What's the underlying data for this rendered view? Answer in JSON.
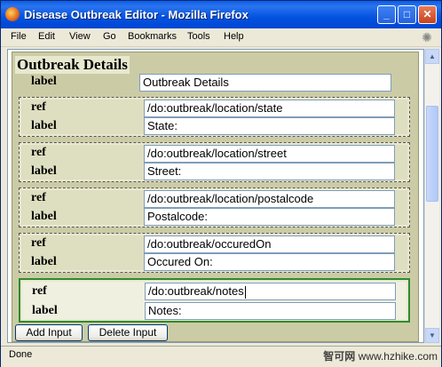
{
  "window": {
    "title": "Disease Outbreak Editor - Mozilla Firefox",
    "minimize_label": "_",
    "maximize_label": "□",
    "close_label": "✕"
  },
  "menu": [
    "File",
    "Edit",
    "View",
    "Go",
    "Bookmarks",
    "Tools",
    "Help"
  ],
  "editor": {
    "heading": "Outbreak Details",
    "label_caption": "label",
    "label_value": "Outbreak Details",
    "ref_caption": "ref",
    "groups": [
      {
        "ref": "/do:outbreak/location/state",
        "label": "State:"
      },
      {
        "ref": "/do:outbreak/location/street",
        "label": "Street:"
      },
      {
        "ref": "/do:outbreak/location/postalcode",
        "label": "Postalcode:"
      },
      {
        "ref": "/do:outbreak/occuredOn",
        "label": "Occured On:"
      },
      {
        "ref": "/do:outbreak/notes",
        "label": "Notes:"
      }
    ],
    "add_input_label": "Add Input",
    "delete_input_label": "Delete Input"
  },
  "status": {
    "text": "Done"
  },
  "watermark": {
    "brand": "智可网",
    "url": "www.hzhike.com"
  }
}
